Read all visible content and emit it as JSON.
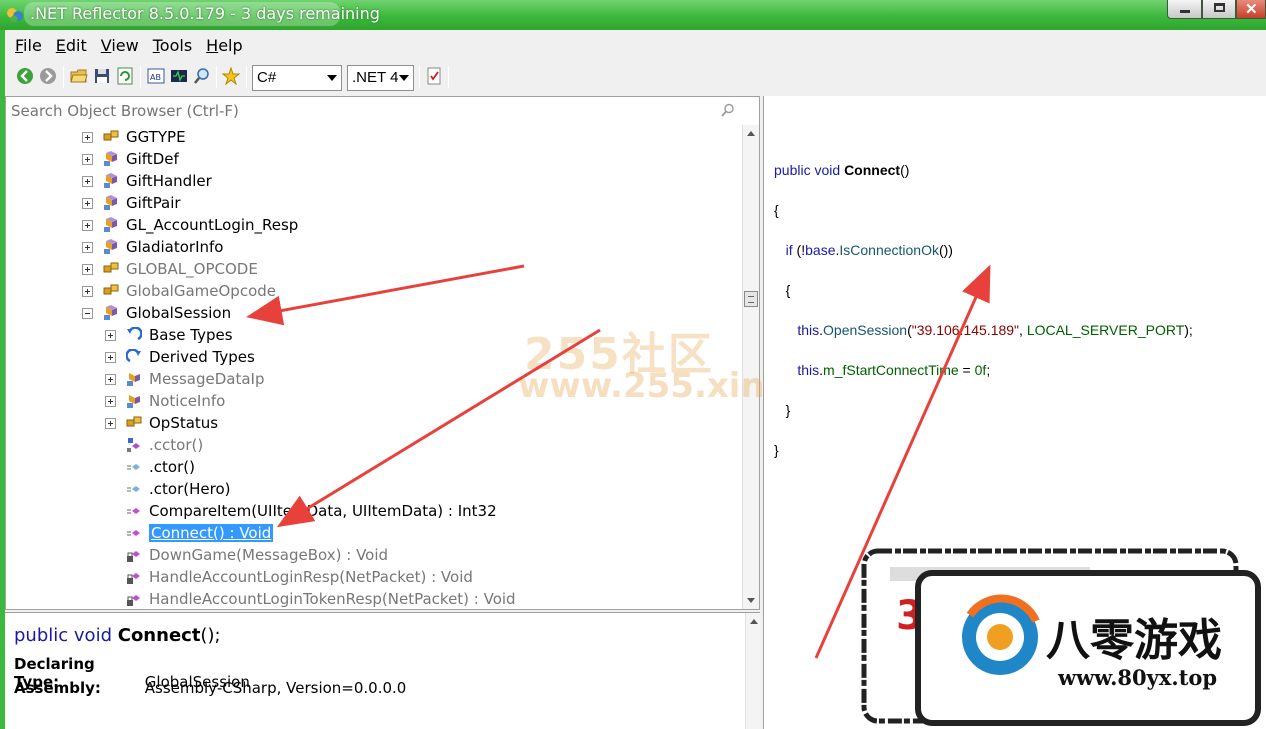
{
  "window": {
    "title": ".NET Reflector 8.5.0.179 - 3 days remaining"
  },
  "menu": [
    {
      "label": "File",
      "accel": "F",
      "rest": "ile"
    },
    {
      "label": "Edit",
      "accel": "E",
      "rest": "dit"
    },
    {
      "label": "View",
      "accel": "V",
      "rest": "iew"
    },
    {
      "label": "Tools",
      "accel": "T",
      "rest": "ools"
    },
    {
      "label": "Help",
      "accel": "H",
      "rest": "elp"
    }
  ],
  "toolbar": {
    "language": "C#",
    "framework": ".NET 4",
    "icons": [
      "back-icon",
      "forward-icon",
      "open-icon",
      "save-icon",
      "refresh-icon",
      "ab-icon",
      "il-icon",
      "search-icon",
      "favorite-icon",
      "notes-icon"
    ]
  },
  "search": {
    "placeholder": "Search Object Browser (Ctrl-F)"
  },
  "tree": [
    {
      "label": "GGTYPE",
      "icon": "enum-icon",
      "expander": "plus",
      "level": 0
    },
    {
      "label": "GiftDef",
      "icon": "class-icon",
      "expander": "plus",
      "level": 0
    },
    {
      "label": "GiftHandler",
      "icon": "class-icon",
      "expander": "plus",
      "level": 0
    },
    {
      "label": "GiftPair",
      "icon": "class-icon",
      "expander": "plus",
      "level": 0
    },
    {
      "label": "GL_AccountLogin_Resp",
      "icon": "class-icon",
      "expander": "plus",
      "level": 0
    },
    {
      "label": "GladiatorInfo",
      "icon": "class-icon",
      "expander": "plus",
      "level": 0
    },
    {
      "label": "GLOBAL_OPCODE",
      "icon": "enum-icon",
      "expander": "plus",
      "level": 0,
      "grey": true
    },
    {
      "label": "GlobalGameOpcode",
      "icon": "enum-icon",
      "expander": "plus",
      "level": 0,
      "grey": true
    },
    {
      "label": "GlobalSession",
      "icon": "class-icon",
      "expander": "minus",
      "level": 0
    },
    {
      "label": "Base Types",
      "icon": "base-types-icon",
      "expander": "plus",
      "level": 1
    },
    {
      "label": "Derived Types",
      "icon": "derived-types-icon",
      "expander": "plus",
      "level": 1
    },
    {
      "label": "MessageDataIp",
      "icon": "nested-class-icon",
      "expander": "plus",
      "level": 1,
      "grey": true
    },
    {
      "label": "NoticeInfo",
      "icon": "nested-class-icon",
      "expander": "plus",
      "level": 1,
      "grey": true
    },
    {
      "label": "OpStatus",
      "icon": "enum-icon",
      "expander": "plus",
      "level": 1
    },
    {
      "label": ".cctor()",
      "icon": "static-method-icon",
      "expander": "none",
      "level": 1,
      "grey": true
    },
    {
      "label": ".ctor()",
      "icon": "constructor-icon",
      "expander": "none",
      "level": 1
    },
    {
      "label": ".ctor(Hero)",
      "icon": "constructor-icon",
      "expander": "none",
      "level": 1
    },
    {
      "label": "CompareItem(UIItemData, UIItemData) : Int32",
      "icon": "method-icon",
      "expander": "none",
      "level": 1
    },
    {
      "label": "Connect() : Void",
      "icon": "method-icon",
      "expander": "none",
      "level": 1,
      "selected": true
    },
    {
      "label": "DownGame(MessageBox) : Void",
      "icon": "private-method-icon",
      "expander": "none",
      "level": 1,
      "grey": true
    },
    {
      "label": "HandleAccountLoginResp(NetPacket) : Void",
      "icon": "private-method-icon",
      "expander": "none",
      "level": 1,
      "grey": true
    },
    {
      "label": "HandleAccountLoginTokenResp(NetPacket) : Void",
      "icon": "private-method-icon",
      "expander": "none",
      "level": 1,
      "grey": true
    }
  ],
  "code": {
    "l1_kw1": "public",
    "l1_kw2": "void",
    "l1_name": "Connect",
    "l1_parens": "()",
    "brace_open": "{",
    "l3_if": "if",
    "l3_paren": " (!",
    "l3_base": "base",
    "l3_dot": ".",
    "l3_call": "IsConnectionOk",
    "l3_end": "())",
    "inner_open": "{",
    "l5_this": "this",
    "l5_dot": ".",
    "l5_call": "OpenSession",
    "l5_paren": "(",
    "l5_str": "\"39.106.145.189\"",
    "l5_comma": ", ",
    "l5_const": "LOCAL_SERVER_PORT",
    "l5_end": ");",
    "l6_this": "this",
    "l6_dot": ".",
    "l6_field": "m_fStartConnectTime",
    "l6_assign": " = ",
    "l6_val": "0f",
    "l6_end": ";",
    "inner_close": "}",
    "brace_close": "}"
  },
  "info": {
    "sig_kw1": "public",
    "sig_kw2": "void",
    "sig_name": "Connect",
    "sig_end": "();",
    "declaring_label": "Declaring Type:",
    "declaring_value": "GlobalSession",
    "assembly_label": "Assembly:",
    "assembly_value": "Assembly-CSharp, Version=0.0.0.0"
  },
  "watermarks": {
    "site1": "255社区",
    "site1_url": "www.255.xin",
    "site2": "八零游戏",
    "site2_url": "www.80yx.top"
  },
  "colors": {
    "titlebar": "#3cb83c",
    "selection": "#3399ff",
    "arrow": "#e8413c"
  }
}
